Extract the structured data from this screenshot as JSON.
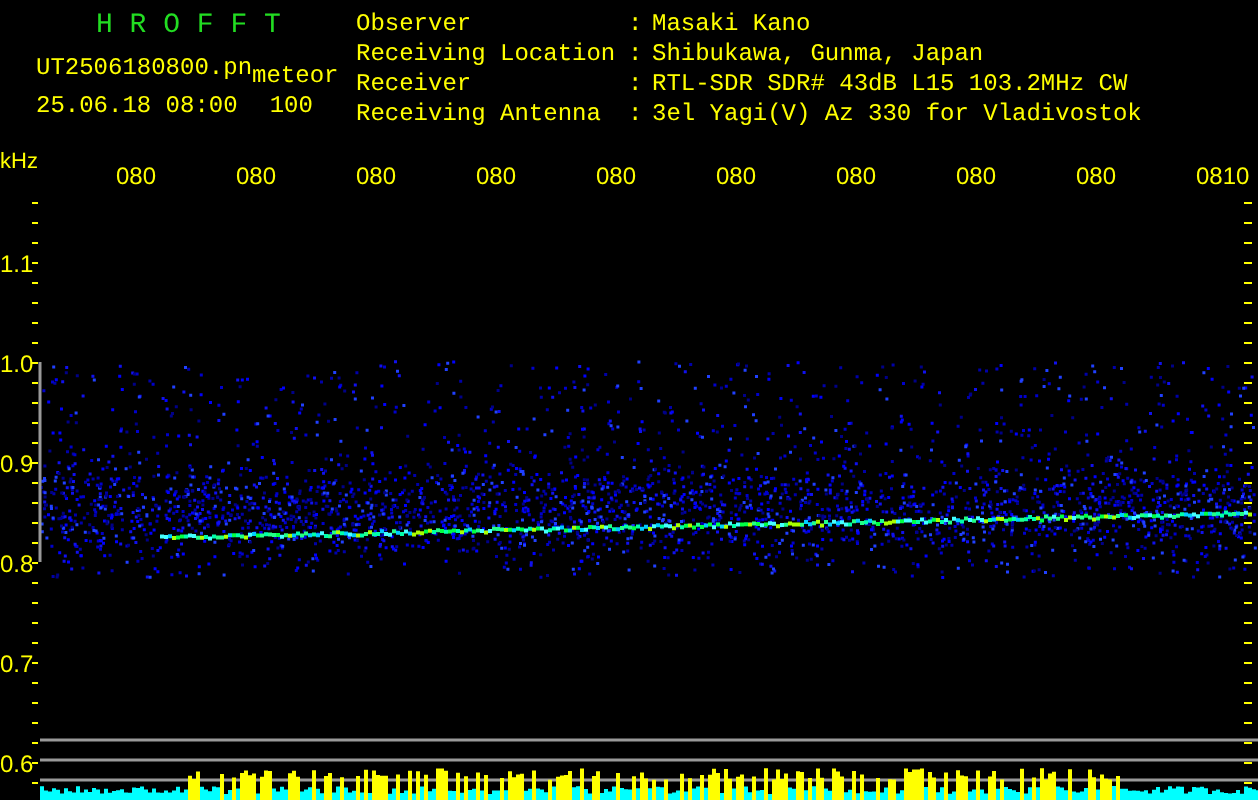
{
  "header": {
    "title": "H R O F F T",
    "filename": "UT2506180800.pn",
    "mode": "meteor",
    "datetime": "25.06.18 08:00",
    "count": "100"
  },
  "info": [
    {
      "label": "Observer",
      "separator": ":",
      "value": "Masaki Kano"
    },
    {
      "label": "Receiving Location",
      "separator": ":",
      "value": "Shibukawa, Gunma, Japan"
    },
    {
      "label": "Receiver",
      "separator": ":",
      "value": "RTL-SDR SDR# 43dB L15 103.2MHz CW"
    },
    {
      "label": "Receiving Antenna",
      "separator": ":",
      "value": "3el Yagi(V) Az 330 for Vladivostok"
    }
  ],
  "spectrogram": {
    "y_unit": "kHz",
    "x_labels": [
      "080",
      "080",
      "080",
      "080",
      "080",
      "080",
      "080",
      "080",
      "080",
      "0810"
    ],
    "y_labels": [
      "1.1",
      "1.0",
      "0.9",
      "0.8",
      "0.7",
      "0.6"
    ]
  }
}
